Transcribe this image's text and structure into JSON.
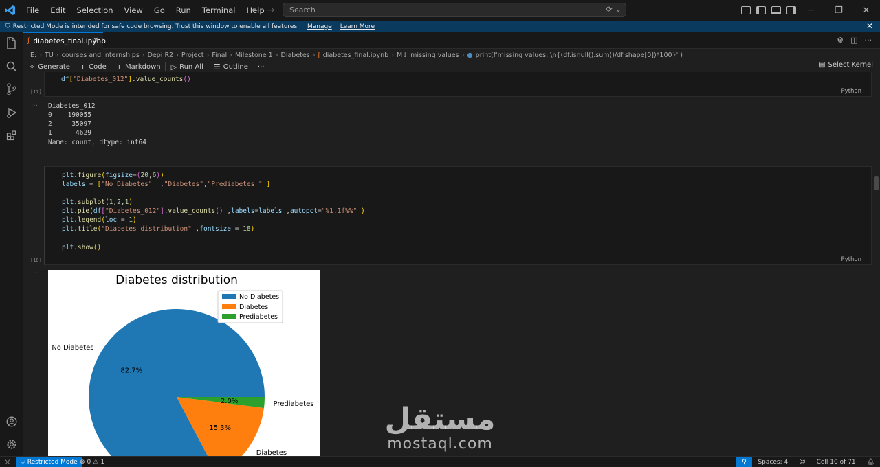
{
  "menu": [
    "File",
    "Edit",
    "Selection",
    "View",
    "Go",
    "Run",
    "Terminal",
    "Help"
  ],
  "search": {
    "placeholder": "Search"
  },
  "banner": {
    "text": "Restricted Mode is intended for safe code browsing. Trust this window to enable all features.",
    "manage": "Manage",
    "learn_more": "Learn More"
  },
  "tab": {
    "label": "diabetes_final.ipynb"
  },
  "breadcrumb": [
    "E:",
    "TU",
    "courses and internships",
    "Depi R2",
    "Project",
    "Final",
    "Milestone 1",
    "Diabetes",
    "diabetes_final.ipynb",
    "missing values",
    "print(f'missing values: \\n{(df.isnull().sum()/df.shape[0])*100}' )"
  ],
  "toolbar": {
    "generate": "Generate",
    "code": "Code",
    "markdown": "Markdown",
    "run_all": "Run All",
    "outline": "Outline",
    "more": "···",
    "select_kernel": "Select Kernel"
  },
  "cells": {
    "c17": {
      "count": "[17]",
      "lang": "Python",
      "output": [
        "Diabetes_012",
        "0    190055",
        "2     35097",
        "1      4629",
        "Name: count, dtype: int64"
      ]
    },
    "c18": {
      "count": "[18]",
      "lang": "Python"
    },
    "out_dots": "···"
  },
  "chart_data": {
    "type": "pie",
    "title": "Diabetes distribution",
    "categories": [
      "No Diabetes",
      "Diabetes",
      "Prediabetes"
    ],
    "values": [
      82.7,
      15.3,
      2.0
    ],
    "value_labels": [
      "82.7%",
      "15.3%",
      "2.0%"
    ],
    "colors": [
      "#1f77b4",
      "#ff7f0e",
      "#2ca02c"
    ],
    "legend": "top-right",
    "legend_labels": [
      "No Diabetes",
      "Diabetes",
      "Prediabetes"
    ]
  },
  "status": {
    "restricted_mode": "Restricted Mode",
    "errors": "0",
    "warnings": "1",
    "spaces": "Spaces: 4",
    "cell": "Cell 10 of 71"
  },
  "watermark": {
    "arabic": "مستقل",
    "latin": "mostaql.com"
  }
}
